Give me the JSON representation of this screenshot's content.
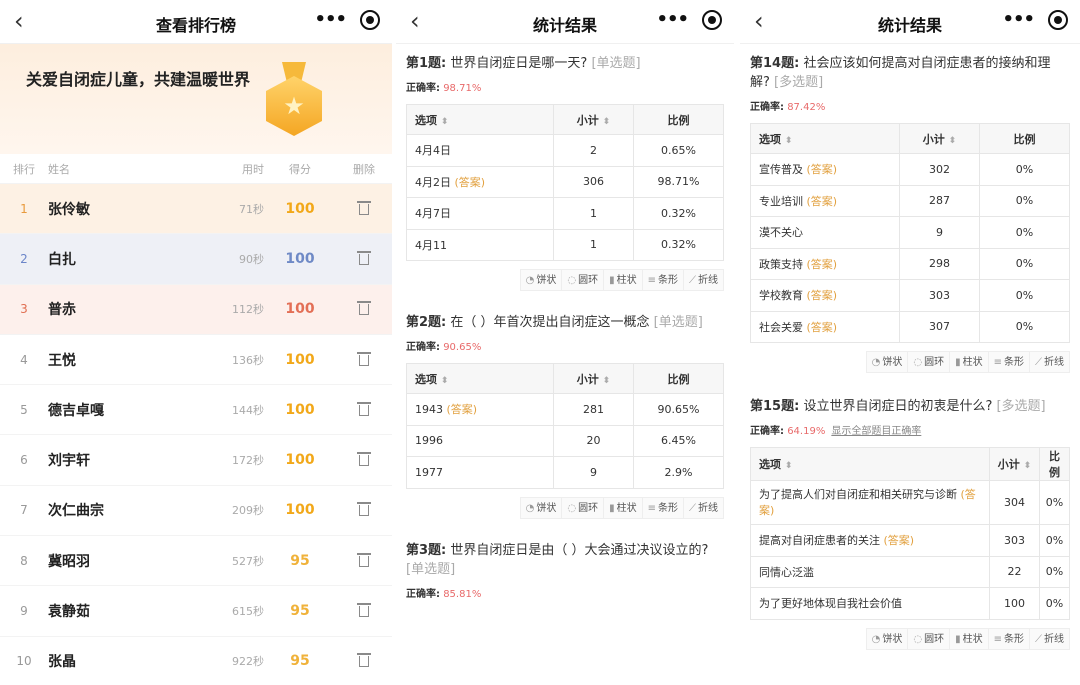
{
  "leaderboard": {
    "title": "查看排行榜",
    "banner": "关爱自闭症儿童，共建温暖世界",
    "headers": {
      "rank": "排行",
      "name": "姓名",
      "time": "用时",
      "score": "得分",
      "delete": "删除"
    },
    "rows": [
      {
        "rank": "1",
        "name": "张伶敏",
        "time": "71秒",
        "score": "100"
      },
      {
        "rank": "2",
        "name": "白扎",
        "time": "90秒",
        "score": "100"
      },
      {
        "rank": "3",
        "name": "普赤",
        "time": "112秒",
        "score": "100"
      },
      {
        "rank": "4",
        "name": "王悦",
        "time": "136秒",
        "score": "100"
      },
      {
        "rank": "5",
        "name": "德吉卓嘎",
        "time": "144秒",
        "score": "100"
      },
      {
        "rank": "6",
        "name": "刘宇轩",
        "time": "172秒",
        "score": "100"
      },
      {
        "rank": "7",
        "name": "次仁曲宗",
        "time": "209秒",
        "score": "100"
      },
      {
        "rank": "8",
        "name": "冀昭羽",
        "time": "527秒",
        "score": "95"
      },
      {
        "rank": "9",
        "name": "袁静茹",
        "time": "615秒",
        "score": "95"
      },
      {
        "rank": "10",
        "name": "张晶",
        "time": "922秒",
        "score": "95"
      }
    ]
  },
  "stats": {
    "title": "统计结果",
    "acc_label": "正确率:",
    "answer_tag": "(答案)",
    "headers": {
      "option": "选项",
      "count": "小计",
      "ratio": "比例",
      "ratio_split_a": "比",
      "ratio_split_b": "例"
    },
    "tools": [
      "饼状",
      "圆环",
      "柱状",
      "条形",
      "折线"
    ],
    "questions": [
      {
        "no": "第1题:",
        "text": "世界自闭症日是哪一天?",
        "type": "[单选题]",
        "accuracy": "98.71%",
        "rows": [
          {
            "option": "4月4日",
            "answer": false,
            "count": "2",
            "ratio": "0.65%"
          },
          {
            "option": "4月2日",
            "answer": true,
            "count": "306",
            "ratio": "98.71%"
          },
          {
            "option": "4月7日",
            "answer": false,
            "count": "1",
            "ratio": "0.32%"
          },
          {
            "option": "4月11",
            "answer": false,
            "count": "1",
            "ratio": "0.32%"
          }
        ]
      },
      {
        "no": "第2题:",
        "text": "在（ ）年首次提出自闭症这一概念",
        "type": "[单选题]",
        "accuracy": "90.65%",
        "rows": [
          {
            "option": "1943",
            "answer": true,
            "count": "281",
            "ratio": "90.65%"
          },
          {
            "option": "1996",
            "answer": false,
            "count": "20",
            "ratio": "6.45%"
          },
          {
            "option": "1977",
            "answer": false,
            "count": "9",
            "ratio": "2.9%"
          }
        ]
      },
      {
        "no": "第3题:",
        "text": "世界自闭症日是由（ ）大会通过决议设立的?",
        "type": "[单选题]",
        "accuracy": "85.81%"
      },
      {
        "no": "第14题:",
        "text": "社会应该如何提高对自闭症患者的接纳和理解?",
        "type": "[多选题]",
        "accuracy": "87.42%",
        "rows": [
          {
            "option": "宣传普及",
            "answer": true,
            "count": "302",
            "ratio": "0%"
          },
          {
            "option": "专业培训",
            "answer": true,
            "count": "287",
            "ratio": "0%"
          },
          {
            "option": "漠不关心",
            "answer": false,
            "count": "9",
            "ratio": "0%"
          },
          {
            "option": "政策支持",
            "answer": true,
            "count": "298",
            "ratio": "0%"
          },
          {
            "option": "学校教育",
            "answer": true,
            "count": "303",
            "ratio": "0%"
          },
          {
            "option": "社会关爱",
            "answer": true,
            "count": "307",
            "ratio": "0%"
          }
        ]
      },
      {
        "no": "第15题:",
        "text": "设立世界自闭症日的初衷是什么?",
        "type": "[多选题]",
        "accuracy": "64.19%",
        "link": "显示全部题目正确率",
        "rows": [
          {
            "option": "为了提高人们对自闭症和相关研究与诊断",
            "answer": true,
            "count": "304",
            "ratio": "0%"
          },
          {
            "option": "提高对自闭症患者的关注",
            "answer": true,
            "count": "303",
            "ratio": "0%"
          },
          {
            "option": "同情心泛滥",
            "answer": false,
            "count": "22",
            "ratio": "0%"
          },
          {
            "option": "为了更好地体现自我社会价值",
            "answer": false,
            "count": "100",
            "ratio": "0%"
          }
        ]
      }
    ]
  }
}
